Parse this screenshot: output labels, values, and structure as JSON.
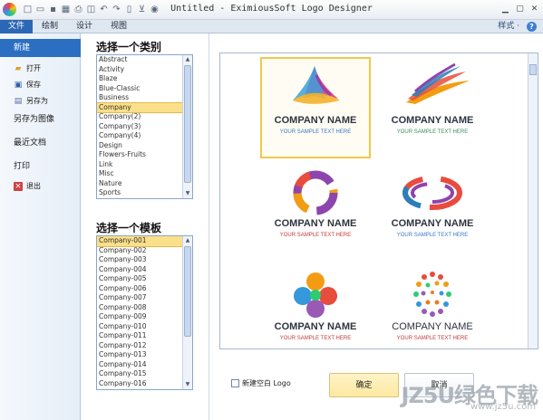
{
  "window": {
    "title": "Untitled - EximiousSoft Logo Designer"
  },
  "ribbon": {
    "tabs": [
      {
        "label": "文件",
        "active": true
      },
      {
        "label": "绘制",
        "active": false
      },
      {
        "label": "设计",
        "active": false
      },
      {
        "label": "视图",
        "active": false
      }
    ],
    "style_menu": "样式 ·",
    "help": "?"
  },
  "file_menu": {
    "items": [
      {
        "label": "新建",
        "selected": true
      },
      {
        "label": "打开",
        "icon": "open-folder-icon"
      },
      {
        "label": "保存",
        "icon": "save-icon"
      },
      {
        "label": "另存为",
        "icon": "save-as-icon"
      },
      {
        "label": "另存为图像"
      },
      {
        "label": "最近文档"
      },
      {
        "label": "打印"
      },
      {
        "label": "退出",
        "icon": "exit-icon"
      }
    ]
  },
  "categories": {
    "title": "选择一个类别",
    "items": [
      "Abstract",
      "Activity",
      "Blaze",
      "Blue-Classic",
      "Business",
      "Company",
      "Company(2)",
      "Company(3)",
      "Company(4)",
      "Design",
      "Flowers-Fruits",
      "Link",
      "Misc",
      "Nature",
      "Sports"
    ],
    "selected": "Company"
  },
  "templates": {
    "title": "选择一个模板",
    "items": [
      "Company-001",
      "Company-002",
      "Company-003",
      "Company-004",
      "Company-005",
      "Company-006",
      "Company-007",
      "Company-008",
      "Company-009",
      "Company-010",
      "Company-011",
      "Company-012",
      "Company-013",
      "Company-014",
      "Company-015",
      "Company-016"
    ],
    "selected": "Company-001"
  },
  "preview": {
    "tiles": [
      {
        "company": "COMPANY NAME",
        "tagline": "YOUR SAMPLE TEXT HERE",
        "logo": "triangle-swirl-logo",
        "selected": true
      },
      {
        "company": "COMPANY NAME",
        "tagline": "YOUR SAMPLE TEXT HERE",
        "logo": "wing-swoosh-logo",
        "selected": false
      },
      {
        "company": "COMPANY NAME",
        "tagline": "YOUR SAMPLE TEXT HERE",
        "logo": "ring-swirl-logo",
        "selected": false
      },
      {
        "company": "COMPANY NAME",
        "tagline": "YOUR SAMPLE TEXT HERE",
        "logo": "orbit-logo",
        "selected": false
      },
      {
        "company": "COMPANY NAME",
        "tagline": "YOUR SAMPLE TEXT HERE",
        "logo": "heart-flower-logo",
        "selected": false
      },
      {
        "company": "COMPANY NAME",
        "tagline": "YOUR SAMPLE TEXT HERE",
        "logo": "dot-spiral-logo",
        "selected": false
      }
    ]
  },
  "bottom": {
    "blank_logo_label": "新建空白 Logo",
    "ok_label": "确定",
    "cancel_label": "取消"
  },
  "watermark": {
    "main": "JZ5U绿色下载",
    "sub": "www.jz5u.com"
  },
  "colors": {
    "accent": "#2c6fc2",
    "selection": "#fbe08a",
    "tagline_blue": "#3778c7",
    "tagline_red": "#c23a3a"
  }
}
